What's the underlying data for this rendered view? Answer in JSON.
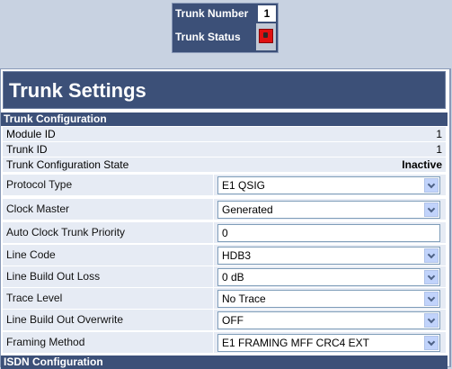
{
  "status_box": {
    "trunk_number_label": "Trunk Number",
    "trunk_number_value": "1",
    "trunk_status_label": "Trunk Status",
    "trunk_status_color": "#e01010"
  },
  "page": {
    "title": "Trunk Settings"
  },
  "sections": {
    "trunk_configuration": "Trunk Configuration",
    "isdn_configuration": "ISDN Configuration"
  },
  "readonly": {
    "module_id_label": "Module ID",
    "module_id_value": "1",
    "trunk_id_label": "Trunk ID",
    "trunk_id_value": "1",
    "state_label": "Trunk Configuration State",
    "state_value": "Inactive"
  },
  "fields": {
    "protocol_type": {
      "label": "Protocol Type",
      "value": "E1 QSIG"
    },
    "clock_master": {
      "label": "Clock Master",
      "value": "Generated"
    },
    "auto_clock_priority": {
      "label": "Auto Clock Trunk Priority",
      "value": "0"
    },
    "line_code": {
      "label": "Line Code",
      "value": "HDB3"
    },
    "line_build_out_loss": {
      "label": "Line Build Out Loss",
      "value": "0 dB"
    },
    "trace_level": {
      "label": "Trace Level",
      "value": "No Trace"
    },
    "line_build_out_overwrite": {
      "label": "Line Build Out Overwrite",
      "value": "OFF"
    },
    "framing_method": {
      "label": "Framing Method",
      "value": "E1 FRAMING MFF CRC4 EXT"
    }
  }
}
